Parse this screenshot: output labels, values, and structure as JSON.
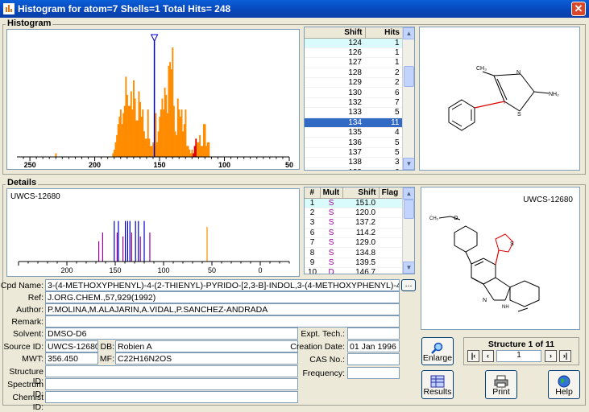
{
  "window": {
    "title": "Histogram for atom=7 Shells=1 Total Hits= 248"
  },
  "histogram": {
    "label": "Histogram",
    "axis_ticks": [
      "250",
      "200",
      "150",
      "100",
      "50"
    ],
    "table": {
      "headers": [
        "Shift",
        "Hits"
      ],
      "rows": [
        [
          "124",
          "1"
        ],
        [
          "126",
          "1"
        ],
        [
          "127",
          "1"
        ],
        [
          "128",
          "2"
        ],
        [
          "129",
          "2"
        ],
        [
          "130",
          "6"
        ],
        [
          "132",
          "7"
        ],
        [
          "133",
          "5"
        ],
        [
          "134",
          "11"
        ],
        [
          "135",
          "4"
        ],
        [
          "136",
          "5"
        ],
        [
          "137",
          "5"
        ],
        [
          "138",
          "3"
        ],
        [
          "139",
          "6"
        ]
      ],
      "selected_index": 8
    }
  },
  "details": {
    "label": "Details",
    "spectrum_title": "UWCS-12680",
    "axis_ticks": [
      "200",
      "150",
      "100",
      "50",
      "0"
    ],
    "table": {
      "headers": [
        "#",
        "Mult",
        "Shift",
        "Flag"
      ],
      "rows": [
        [
          "1",
          "S",
          "151.0",
          ""
        ],
        [
          "2",
          "S",
          "120.0",
          ""
        ],
        [
          "3",
          "S",
          "137.2",
          ""
        ],
        [
          "6",
          "S",
          "114.2",
          ""
        ],
        [
          "7",
          "S",
          "129.0",
          ""
        ],
        [
          "8",
          "S",
          "134.8",
          ""
        ],
        [
          "9",
          "S",
          "139.5",
          ""
        ],
        [
          "10",
          "D",
          "146.7",
          ""
        ]
      ]
    },
    "structure_label": "UWCS-12680"
  },
  "form": {
    "cpd_name_label": "Cpd Name:",
    "cpd_name": "3-(4-METHOXYPHENYL)-4-(2-THIENYL)-PYRIDO-[2,3-B]-INDOL,3-(4-METHOXYPHENYL)-4-(2-THIENYL)-ALPHA-CAR",
    "cpd_more": "...",
    "ref_label": "Ref:",
    "ref": "J.ORG.CHEM.,57,929(1992)",
    "author_label": "Author:",
    "author": "P.MOLINA,M.ALAJARIN,A.VIDAL,P.SANCHEZ-ANDRADA",
    "remark_label": "Remark:",
    "remark": "",
    "solvent_label": "Solvent:",
    "solvent": "DMSO-D6",
    "source_id_label": "Source ID:",
    "source_id": "UWCS-12680",
    "db_label": "DB:",
    "db": "Robien A",
    "mwt_label": "MWT:",
    "mwt": "356.450",
    "mf_label": "MF:",
    "mf": "C22H16N2OS",
    "structure_id_label": "Structure ID:",
    "spectrum_id_label": "Spectrum ID:",
    "chemist_id_label": "Chemist ID:",
    "expt_tech_label": "Expt. Tech.:",
    "creation_date_label": "Creation Date:",
    "creation_date": "01 Jan 1996",
    "cas_label": "CAS No.:",
    "frequency_label": "Frequency:"
  },
  "nav": {
    "title": "Structure 1 of 11",
    "current": "1"
  },
  "buttons": {
    "enlarge": "Enlarge",
    "results": "Results",
    "print": "Print",
    "help": "Help"
  },
  "chart_data": {
    "type": "bar",
    "title": "",
    "x_label": "",
    "y_label": "",
    "x_direction": "reversed",
    "x_range": [
      260,
      50
    ],
    "cursor_x": 154,
    "ticks": [
      250,
      200,
      150,
      100,
      50
    ],
    "x": [
      230,
      186,
      185,
      184,
      183,
      182,
      181,
      180,
      179,
      178,
      177,
      176,
      175,
      174,
      173,
      172,
      171,
      170,
      169,
      168,
      167,
      166,
      165,
      164,
      163,
      162,
      161,
      160,
      159,
      158,
      157,
      156,
      155,
      154,
      153,
      152,
      151,
      150,
      149,
      148,
      147,
      146,
      145,
      144,
      143,
      142,
      141,
      140,
      139,
      138,
      137,
      136,
      135,
      134,
      133,
      132,
      131,
      130,
      129,
      128,
      127,
      126,
      125,
      124,
      123,
      122,
      121,
      120,
      119,
      118,
      117,
      116,
      115,
      114,
      113,
      112
    ],
    "values": [
      1,
      1,
      2,
      4,
      6,
      9,
      11,
      13,
      9,
      12,
      14,
      22,
      17,
      14,
      14,
      18,
      13,
      21,
      16,
      10,
      10,
      18,
      15,
      11,
      13,
      7,
      5,
      5,
      13,
      5,
      3,
      3,
      4,
      3,
      12,
      4,
      7,
      11,
      13,
      16,
      13,
      19,
      17,
      12,
      25,
      26,
      24,
      30,
      14,
      7,
      6,
      16,
      13,
      11,
      13,
      7,
      9,
      13,
      3,
      3,
      2,
      1,
      2,
      1,
      3,
      5,
      4,
      4,
      6,
      3,
      3,
      9,
      9,
      3,
      4,
      4
    ],
    "colors": {
      "bar": "#ff8c00",
      "cursor": "#0000cc",
      "highlight": "#e00000"
    }
  },
  "detail_chart": {
    "type": "stick",
    "x_direction": "reversed",
    "x_range": [
      250,
      -30
    ],
    "lines": [
      {
        "x": 167,
        "h": 0.42,
        "color": "#990099"
      },
      {
        "x": 163,
        "h": 0.6,
        "color": "#990099"
      },
      {
        "x": 151,
        "h": 0.84,
        "color": "#0000cc"
      },
      {
        "x": 148,
        "h": 0.6,
        "color": "#990099"
      },
      {
        "x": 146.7,
        "h": 0.84,
        "color": "#0000cc"
      },
      {
        "x": 142,
        "h": 0.52,
        "color": "#990099"
      },
      {
        "x": 139.5,
        "h": 0.84,
        "color": "#0000cc"
      },
      {
        "x": 137.2,
        "h": 0.84,
        "color": "#0000cc"
      },
      {
        "x": 134.8,
        "h": 0.84,
        "color": "#0000cc"
      },
      {
        "x": 133,
        "h": 0.6,
        "color": "#990099"
      },
      {
        "x": 129,
        "h": 0.84,
        "color": "#0000cc"
      },
      {
        "x": 126,
        "h": 0.84,
        "color": "#0000cc"
      },
      {
        "x": 124,
        "h": 0.52,
        "color": "#990099"
      },
      {
        "x": 120,
        "h": 0.84,
        "color": "#0000cc"
      },
      {
        "x": 114.2,
        "h": 0.6,
        "color": "#990099"
      },
      {
        "x": 55,
        "h": 0.72,
        "color": "#ff8c00"
      }
    ]
  }
}
